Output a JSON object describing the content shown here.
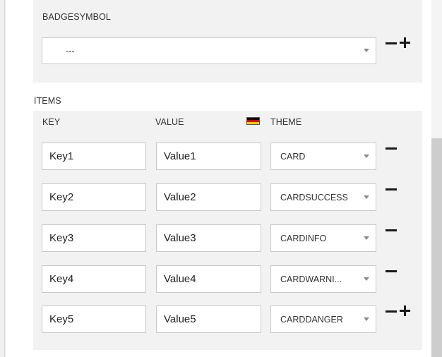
{
  "badge_symbol": {
    "label": "BADGESYMBOL",
    "selected": "---"
  },
  "items_section": {
    "label": "ITEMS",
    "columns": {
      "key": "KEY",
      "value": "VALUE",
      "theme": "THEME"
    },
    "flag_colors": [
      "#000000",
      "#dd0000",
      "#ffce00"
    ],
    "flag_icon": "german-flag-icon",
    "rows": [
      {
        "key": "Key1",
        "value": "Value1",
        "theme": "CARD"
      },
      {
        "key": "Key2",
        "value": "Value2",
        "theme": "CARDSUCCESS"
      },
      {
        "key": "Key3",
        "value": "Value3",
        "theme": "CARDINFO"
      },
      {
        "key": "Key4",
        "value": "Value4",
        "theme": "CARDWARNI..."
      },
      {
        "key": "Key5",
        "value": "Value5",
        "theme": "CARDDANGER"
      }
    ]
  },
  "icons": {
    "remove": "minus-icon",
    "add": "plus-icon",
    "dropdown": "chevron-down-icon"
  }
}
